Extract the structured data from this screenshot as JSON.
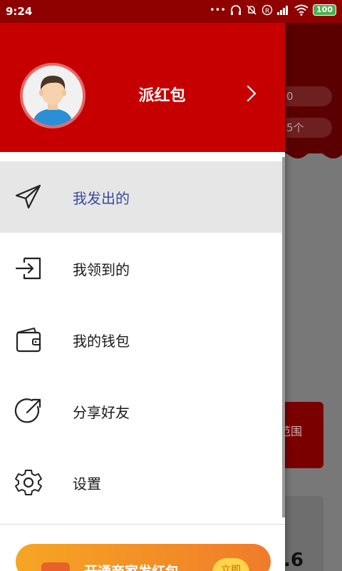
{
  "status_bar": {
    "time": "9:24",
    "battery": "100",
    "icons": [
      "more-icon",
      "headset-icon",
      "mute-bell-icon",
      "registered-icon",
      "signal-icon",
      "wifi-icon",
      "battery-icon"
    ]
  },
  "background": {
    "pill_1": "0",
    "pill_2": "5个",
    "card_text": "范围",
    "number": ".6"
  },
  "drawer": {
    "header": {
      "title": "派红包",
      "avatar_icon": "user-avatar-icon",
      "chevron_icon": "chevron-right-icon"
    },
    "menu": [
      {
        "label": "我发出的",
        "icon": "paper-plane-icon",
        "active": true
      },
      {
        "label": "我领到的",
        "icon": "sign-in-icon",
        "active": false
      },
      {
        "label": "我的钱包",
        "icon": "wallet-icon",
        "active": false
      },
      {
        "label": "分享好友",
        "icon": "share-arrow-icon",
        "active": false
      },
      {
        "label": "设置",
        "icon": "gear-icon",
        "active": false
      }
    ],
    "banner": {
      "text": "开通商家发红包",
      "button": "立即"
    }
  },
  "colors": {
    "header_red": "#c60000",
    "active_label": "#3a4a9f",
    "active_bg": "#e6e6e6"
  }
}
